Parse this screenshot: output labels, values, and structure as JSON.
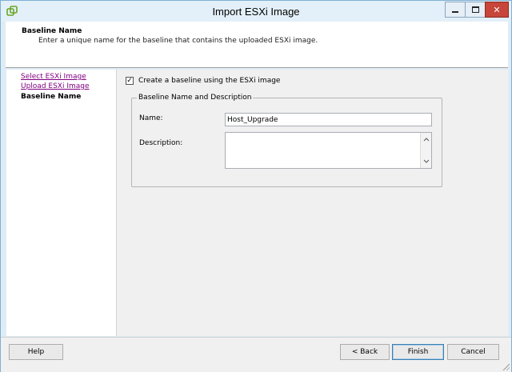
{
  "window": {
    "title": "Import ESXi Image",
    "accent": "#7fb0d4",
    "close_color": "#c8453a"
  },
  "header": {
    "title": "Baseline Name",
    "description": "Enter a unique name for the baseline that contains the uploaded ESXi image."
  },
  "nav": {
    "steps": [
      {
        "label": "Select ESXi Image",
        "state": "visited"
      },
      {
        "label": "Upload ESXi Image",
        "state": "visited"
      },
      {
        "label": "Baseline Name",
        "state": "current"
      }
    ]
  },
  "form": {
    "create_checkbox_label": "Create a baseline using the ESXi image",
    "create_checked": true,
    "group_title": "Baseline Name and Description",
    "name_label": "Name:",
    "name_value": "Host_Upgrade",
    "description_label": "Description:",
    "description_value": ""
  },
  "footer": {
    "help": "Help",
    "back": "< Back",
    "finish": "Finish",
    "cancel": "Cancel"
  },
  "icons": {
    "app": "vsphere-logo-icon",
    "minimize": "minimize-icon",
    "maximize": "maximize-icon",
    "close": "close-icon",
    "check": "checkmark-icon",
    "scroll_up": "chevron-up-icon",
    "scroll_down": "chevron-down-icon",
    "resize": "resize-grip-icon"
  }
}
